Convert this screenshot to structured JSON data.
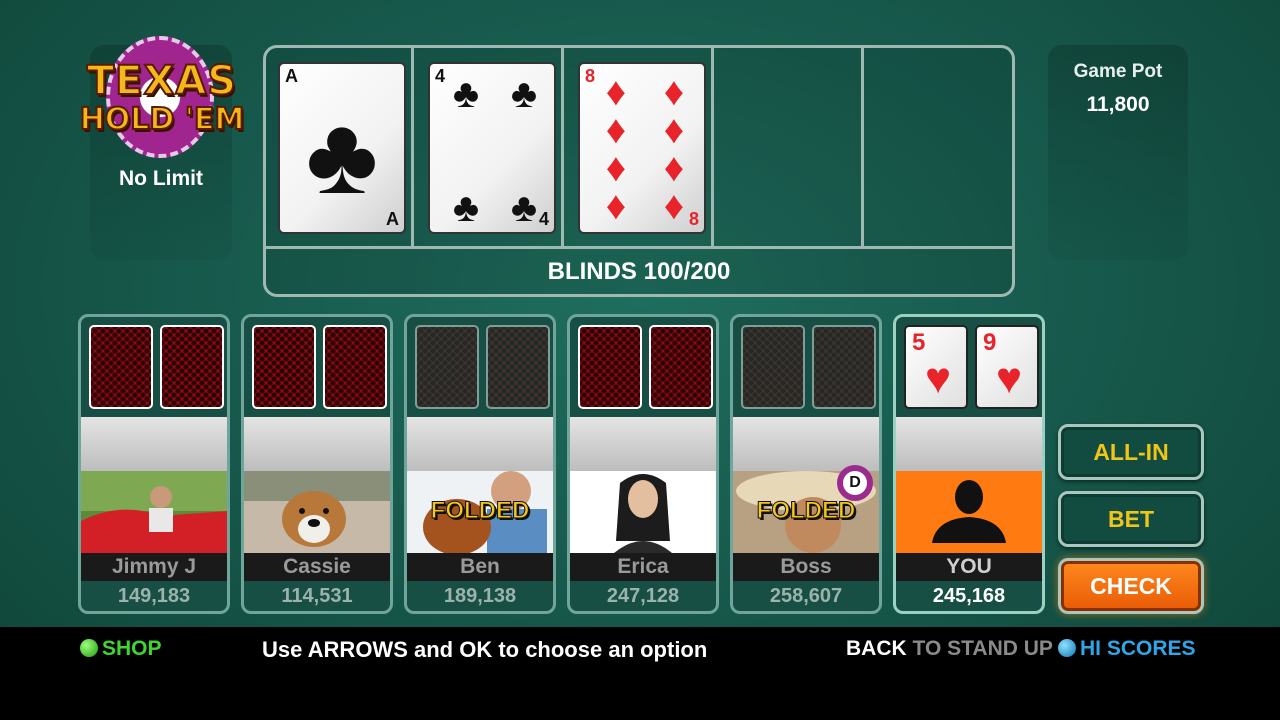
{
  "logo": {
    "line1": "TEXAS",
    "line2": "HOLD 'EM"
  },
  "game_mode": "No Limit",
  "pot": {
    "label": "Game Pot",
    "value": "11,800"
  },
  "board": {
    "blinds": "BLINDS 100/200",
    "cards": [
      {
        "rank": "A",
        "suit": "clubs"
      },
      {
        "rank": "4",
        "suit": "clubs"
      },
      {
        "rank": "8",
        "suit": "diamonds"
      }
    ]
  },
  "players": [
    {
      "name": "Jimmy J",
      "chips": "149,183"
    },
    {
      "name": "Cassie",
      "chips": "114,531"
    },
    {
      "name": "Ben",
      "chips": "189,138",
      "status": "FOLDED"
    },
    {
      "name": "Erica",
      "chips": "247,128"
    },
    {
      "name": "Boss",
      "chips": "258,607",
      "status": "FOLDED",
      "dealer": "D"
    },
    {
      "name": "YOU",
      "chips": "245,168",
      "cards": [
        {
          "rank": "5",
          "suit": "hearts"
        },
        {
          "rank": "9",
          "suit": "hearts"
        }
      ]
    }
  ],
  "actions": {
    "all_in": "ALL-IN",
    "bet": "BET",
    "check": "CHECK"
  },
  "footer": {
    "shop": "SHOP",
    "instructions": "Use ARROWS and OK to choose an option",
    "back_key": "BACK",
    "back_text": " TO STAND UP",
    "hi_scores": "HI SCORES"
  },
  "colors": {
    "felt": "#16574a",
    "accent": "#f0c419",
    "check": "#ff7a10",
    "shop_dot": "#2ecc40",
    "hi_dot": "#1a9ad6"
  }
}
